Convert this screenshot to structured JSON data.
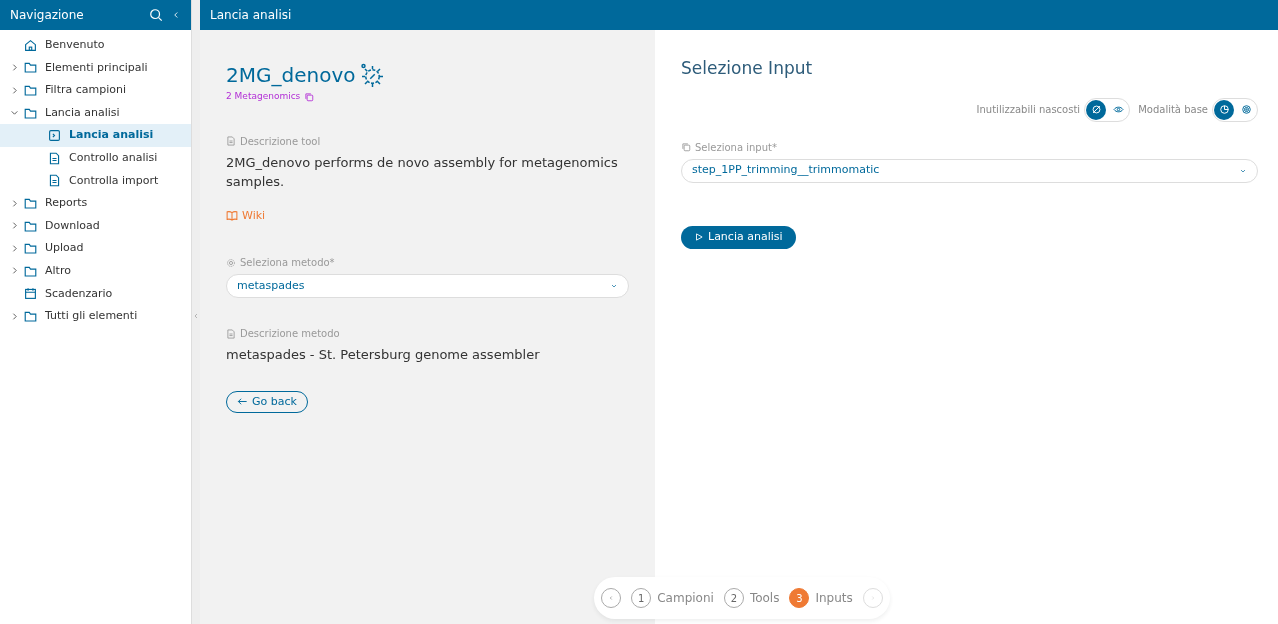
{
  "sidebar": {
    "title": "Navigazione",
    "items": [
      {
        "label": "Benvenuto",
        "kind": "home",
        "selected": false
      },
      {
        "label": "Elementi principali",
        "kind": "folder",
        "expanded": false,
        "selected": false
      },
      {
        "label": "Filtra campioni",
        "kind": "folder",
        "expanded": false,
        "selected": false
      },
      {
        "label": "Lancia analisi",
        "kind": "folder",
        "expanded": true,
        "selected": false,
        "children": [
          {
            "label": "Lancia analisi",
            "kind": "terminal",
            "selected": true
          },
          {
            "label": "Controllo analisi",
            "kind": "doc",
            "selected": false
          },
          {
            "label": "Controlla import",
            "kind": "doc",
            "selected": false
          }
        ]
      },
      {
        "label": "Reports",
        "kind": "folder",
        "expanded": false,
        "selected": false
      },
      {
        "label": "Download",
        "kind": "folder",
        "expanded": false,
        "selected": false
      },
      {
        "label": "Upload",
        "kind": "folder",
        "expanded": false,
        "selected": false
      },
      {
        "label": "Altro",
        "kind": "folder",
        "expanded": false,
        "selected": false
      },
      {
        "label": "Scadenzario",
        "kind": "calendar",
        "selected": false
      },
      {
        "label": "Tutti gli elementi",
        "kind": "folder",
        "expanded": false,
        "selected": false
      }
    ]
  },
  "header": {
    "title": "Lancia analisi"
  },
  "tool": {
    "name": "2MG_denovo",
    "category": "2 Metagenomics",
    "description_label": "Descrizione tool",
    "description": "2MG_denovo performs de novo assembly for metagenomics samples.",
    "wiki": "Wiki",
    "method_label": "Seleziona metodo*",
    "method": "metaspades",
    "method_description_label": "Descrizione metodo",
    "method_description": "metaspades - St. Petersburg genome assembler",
    "back": "Go back"
  },
  "input_panel": {
    "title": "Selezione Input",
    "toggles": [
      {
        "label": "Inutilizzabili nascosti",
        "options": [
          {
            "kind": "hidden",
            "selected": true
          },
          {
            "kind": "visible",
            "selected": false
          }
        ]
      },
      {
        "label": "Modalità base",
        "options": [
          {
            "kind": "basic",
            "selected": true
          },
          {
            "kind": "advanced",
            "selected": false
          }
        ]
      }
    ],
    "input_label": "Seleziona input*",
    "input": "step_1PP_trimming__trimmomatic",
    "run": "Lancia analisi"
  },
  "stepper": {
    "steps": [
      {
        "number": "1",
        "label": "Campioni",
        "selected": false
      },
      {
        "number": "2",
        "label": "Tools",
        "selected": false
      },
      {
        "number": "3",
        "label": "Inputs",
        "selected": true
      }
    ]
  }
}
